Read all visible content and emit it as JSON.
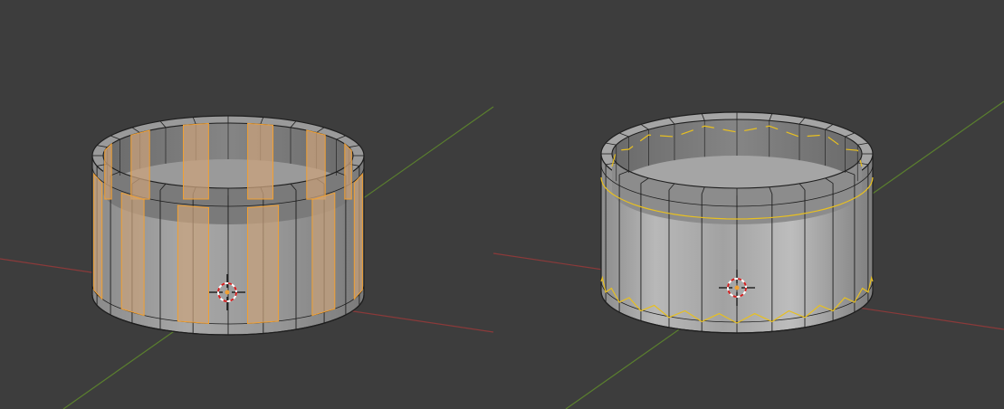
{
  "viewport": {
    "background": "#3d3d3d",
    "axis_x_color": "#8a3a3a",
    "axis_y_color": "#5a7f2e"
  },
  "mesh_colors": {
    "wire": "#1e1e1e",
    "body_light": "#a3a3a3",
    "body_mid": "#8e8e8e",
    "body_dark": "#6e6e6e",
    "inner": "#7c7c7c",
    "selected_face": "#c9a27c",
    "selected_edge": "#f0a033",
    "seam_edge": "#e8c020"
  },
  "views": [
    {
      "id": "left",
      "mode": "edit-mode-with-selected-faces"
    },
    {
      "id": "right",
      "mode": "edit-mode-with-seams"
    }
  ],
  "cursor": {
    "icon": "3d-cursor-icon"
  }
}
